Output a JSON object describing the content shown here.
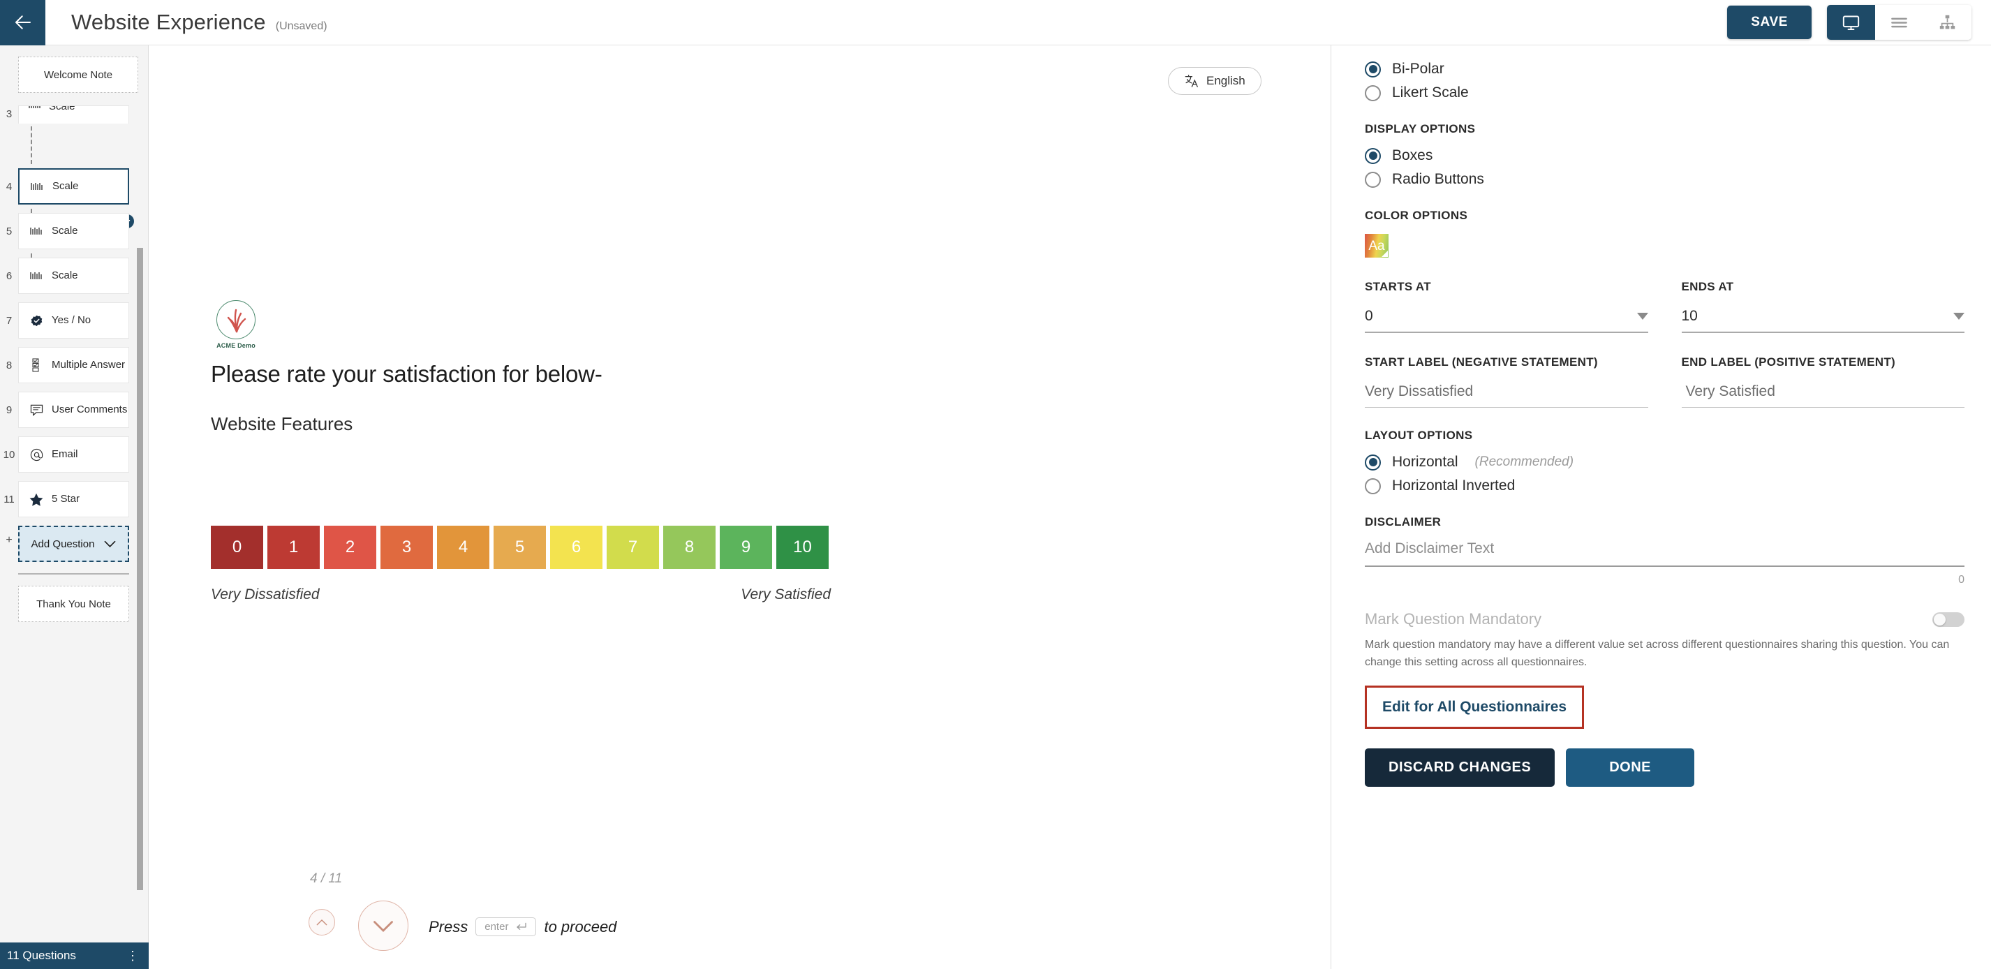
{
  "header": {
    "back_icon": "arrow-left-icon",
    "title": "Website Experience",
    "unsaved": "(Unsaved)",
    "save_label": "SAVE",
    "view_desktop_icon": "monitor-icon",
    "view_list_icon": "list-icon",
    "view_tree_icon": "sitemap-icon"
  },
  "sidebar": {
    "welcome_note": "Welcome Note",
    "clipped_top": {
      "num": "3",
      "label": "Scale",
      "icon": "scale-icon"
    },
    "items": [
      {
        "num": "4",
        "label": "Scale",
        "icon": "scale-icon",
        "selected": true
      },
      {
        "num": "5",
        "label": "Scale",
        "icon": "scale-icon",
        "selected": false
      },
      {
        "num": "6",
        "label": "Scale",
        "icon": "scale-icon",
        "selected": false
      },
      {
        "num": "7",
        "label": "Yes / No",
        "icon": "check-badge-icon",
        "selected": false
      },
      {
        "num": "8",
        "label": "Multiple Answer",
        "icon": "checklist-icon",
        "selected": false
      },
      {
        "num": "9",
        "label": "User Comments",
        "icon": "comment-icon",
        "selected": false
      },
      {
        "num": "10",
        "label": "Email",
        "icon": "at-icon",
        "selected": false
      },
      {
        "num": "11",
        "label": "5 Star",
        "icon": "star-icon",
        "selected": false
      }
    ],
    "add_question": "Add Question",
    "add_question_num": "+",
    "add_question_icon": "chevron-down-icon",
    "thank_you_note": "Thank You Note",
    "footer_count": "11 Questions",
    "footer_menu_icon": "kebab-menu-icon"
  },
  "preview": {
    "language_label": "English",
    "language_icon": "translate-icon",
    "brand_name": "ACME Demo",
    "question_heading": "Please rate your satisfaction for below-",
    "question_subheading": "Website Features",
    "start_label": "Very Dissatisfied",
    "end_label": "Very Satisfied",
    "pager": "4 / 11",
    "nav_up_icon": "chevron-up-icon",
    "nav_down_icon": "chevron-down-icon",
    "press_prefix": "Press",
    "enter_key": "enter",
    "enter_key_icon": "enter-arrow-icon",
    "press_suffix": "to proceed"
  },
  "chart_data": {
    "type": "bar",
    "title": "Website Features",
    "categories": [
      "0",
      "1",
      "2",
      "3",
      "4",
      "5",
      "6",
      "7",
      "8",
      "9",
      "10"
    ],
    "values": [
      0,
      1,
      2,
      3,
      4,
      5,
      6,
      7,
      8,
      9,
      10
    ],
    "colors": [
      "#a32f2c",
      "#bd3a33",
      "#df5547",
      "#e06a3f",
      "#e2953a",
      "#e6aa4f",
      "#f3e34f",
      "#d2dc4c",
      "#95c75b",
      "#5cb45c",
      "#2f9146"
    ],
    "xlabel": "",
    "ylabel": "",
    "legend": [
      "Very Dissatisfied",
      "Very Satisfied"
    ]
  },
  "settings": {
    "scale_type": [
      {
        "label": "Bi-Polar",
        "selected": true
      },
      {
        "label": "Likert Scale",
        "selected": false
      }
    ],
    "display_options_heading": "DISPLAY OPTIONS",
    "display_options": [
      {
        "label": "Boxes",
        "selected": true
      },
      {
        "label": "Radio Buttons",
        "selected": false
      }
    ],
    "color_options_heading": "COLOR OPTIONS",
    "color_swatch_text": "Aa",
    "starts_at_label": "STARTS AT",
    "starts_at_value": "0",
    "ends_at_label": "ENDS AT",
    "ends_at_value": "10",
    "start_label_heading": "START LABEL (NEGATIVE STATEMENT)",
    "start_label_value": "Very Dissatisfied",
    "end_label_heading": "END LABEL (POSITIVE STATEMENT)",
    "end_label_value": "Very Satisfied",
    "layout_options_heading": "LAYOUT OPTIONS",
    "layout_options": [
      {
        "label": "Horizontal",
        "note": "(Recommended)",
        "selected": true
      },
      {
        "label": "Horizontal Inverted",
        "note": "",
        "selected": false
      }
    ],
    "disclaimer_heading": "DISCLAIMER",
    "disclaimer_placeholder": "Add Disclaimer Text",
    "disclaimer_count": "0",
    "mandatory_label": "Mark Question Mandatory",
    "mandatory_desc": "Mark question mandatory may have a different value set across different questionnaires sharing this question. You can change this setting across all questionnaires.",
    "edit_all_label": "Edit for All Questionnaires",
    "discard_label": "DISCARD CHANGES",
    "done_label": "DONE"
  },
  "colors": {
    "brand_dark": "#1e4a67",
    "accent_red": "#b53223",
    "progress_orange": "#c4543a"
  }
}
